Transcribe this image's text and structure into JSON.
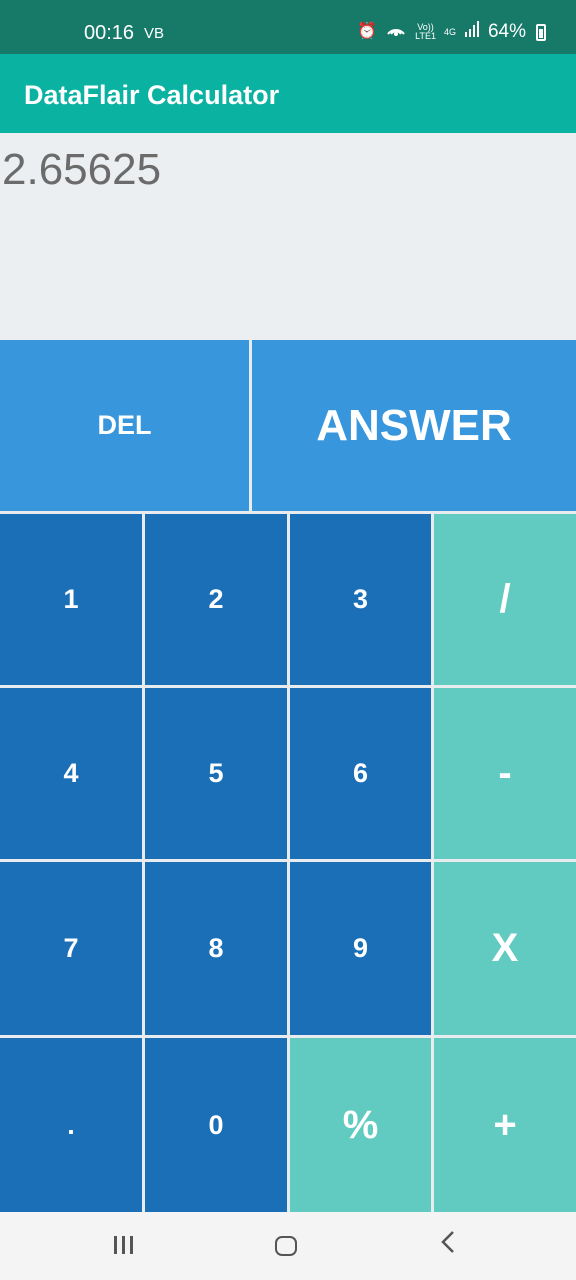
{
  "status_bar": {
    "time": "00:16",
    "carrier": "VB",
    "volte": "Vo))",
    "lte": "LTE1",
    "network": "4G",
    "battery": "64%",
    "icons": [
      "alarm-icon",
      "hotspot-icon",
      "signal-icon",
      "battery-icon"
    ]
  },
  "app_bar": {
    "title": "DataFlair Calculator"
  },
  "display": {
    "value": "2.65625"
  },
  "keys": {
    "del": "DEL",
    "answer": "ANSWER",
    "one": "1",
    "two": "2",
    "three": "3",
    "divide": "/",
    "four": "4",
    "five": "5",
    "six": "6",
    "minus": "-",
    "seven": "7",
    "eight": "8",
    "nine": "9",
    "multiply": "X",
    "dot": ".",
    "zero": "0",
    "percent": "%",
    "plus": "+"
  },
  "colors": {
    "status_bar": "#177a69",
    "app_bar": "#0ab2a2",
    "key_dark": "#1b6fb7",
    "key_light": "#3796dc",
    "key_teal": "#62cbc1"
  },
  "nav_bar": {
    "icons": [
      "recents-icon",
      "home-icon",
      "back-icon"
    ]
  }
}
